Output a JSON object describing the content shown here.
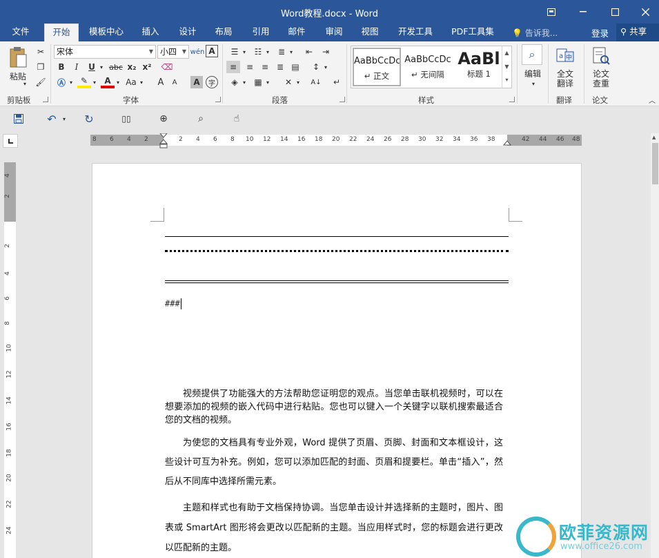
{
  "window": {
    "title": "Word教程.docx - Word",
    "controls": [
      "ribbon-display",
      "minimize",
      "maximize",
      "close"
    ]
  },
  "tabs": [
    {
      "label": "文件"
    },
    {
      "label": "开始",
      "active": true
    },
    {
      "label": "模板中心"
    },
    {
      "label": "插入"
    },
    {
      "label": "设计"
    },
    {
      "label": "布局"
    },
    {
      "label": "引用"
    },
    {
      "label": "邮件"
    },
    {
      "label": "审阅"
    },
    {
      "label": "视图"
    },
    {
      "label": "开发工具"
    },
    {
      "label": "PDF工具集"
    }
  ],
  "tellme": "告诉我...",
  "login": "登录",
  "share": "共享",
  "ribbon": {
    "clipboard": {
      "label": "剪贴板",
      "paste": "粘贴"
    },
    "font": {
      "label": "字体",
      "family": "宋体",
      "size": "小四",
      "bold": "B",
      "italic": "I",
      "underline": "U",
      "strike": "abc",
      "sub": "x₂",
      "sup": "x²",
      "case": "Aa",
      "grow": "A",
      "shrink": "A",
      "phonetic": "wén",
      "border_char": "A",
      "shade_char": "A",
      "enclose": "字"
    },
    "paragraph": {
      "label": "段落"
    },
    "styles": {
      "label": "样式",
      "items": [
        {
          "preview": "AaBbCcDc",
          "name": "↵ 正文"
        },
        {
          "preview": "AaBbCcDc",
          "name": "↵ 无间隔"
        },
        {
          "preview": "AaBl",
          "name": "标题 1"
        }
      ]
    },
    "edit": {
      "label": "编辑"
    },
    "translate": {
      "label": "翻译",
      "btn": "全文\n翻译",
      "btn_l1": "全文",
      "btn_l2": "翻译"
    },
    "paper": {
      "label": "论文",
      "btn_l1": "论文",
      "btn_l2": "查重"
    }
  },
  "ruler": {
    "h_left": [
      "8",
      "6",
      "4",
      "2"
    ],
    "h_right": [
      "2",
      "4",
      "6",
      "8",
      "10",
      "12",
      "14",
      "16",
      "18",
      "20",
      "22",
      "24",
      "26",
      "28",
      "30",
      "32",
      "34",
      "36",
      "38"
    ],
    "h_margin_right": [
      "42",
      "44",
      "46",
      "48"
    ],
    "v_top": [
      "4",
      "2"
    ],
    "v_body": [
      "2",
      "4",
      "6",
      "8",
      "10",
      "12",
      "14",
      "16",
      "18",
      "20",
      "22",
      "24"
    ]
  },
  "document": {
    "hash_text": "###",
    "paragraphs": [
      "视频提供了功能强大的方法帮助您证明您的观点。当您单击联机视频时，可以在想要添加的视频的嵌入代码中进行粘贴。您也可以键入一个关键字以联机搜索最适合您的文档的视频。",
      "为使您的文档具有专业外观，Word 提供了页眉、页脚、封面和文本框设计，这些设计可互为补充。例如，您可以添加匹配的封面、页眉和提要栏。单击“插入”，然后从不同库中选择所需元素。",
      "主题和样式也有助于文档保持协调。当您单击设计并选择新的主题时，图片、图表或 SmartArt 图形将会更改以匹配新的主题。当应用样式时，您的标题会进行更改以匹配新的主题。"
    ]
  },
  "watermark": {
    "name": "欧菲资源网",
    "url": "www.office26.com"
  },
  "colors": {
    "accent": "#2b579a",
    "ribbon_bg": "#f3f3f3",
    "page_bg": "#ffffff"
  }
}
